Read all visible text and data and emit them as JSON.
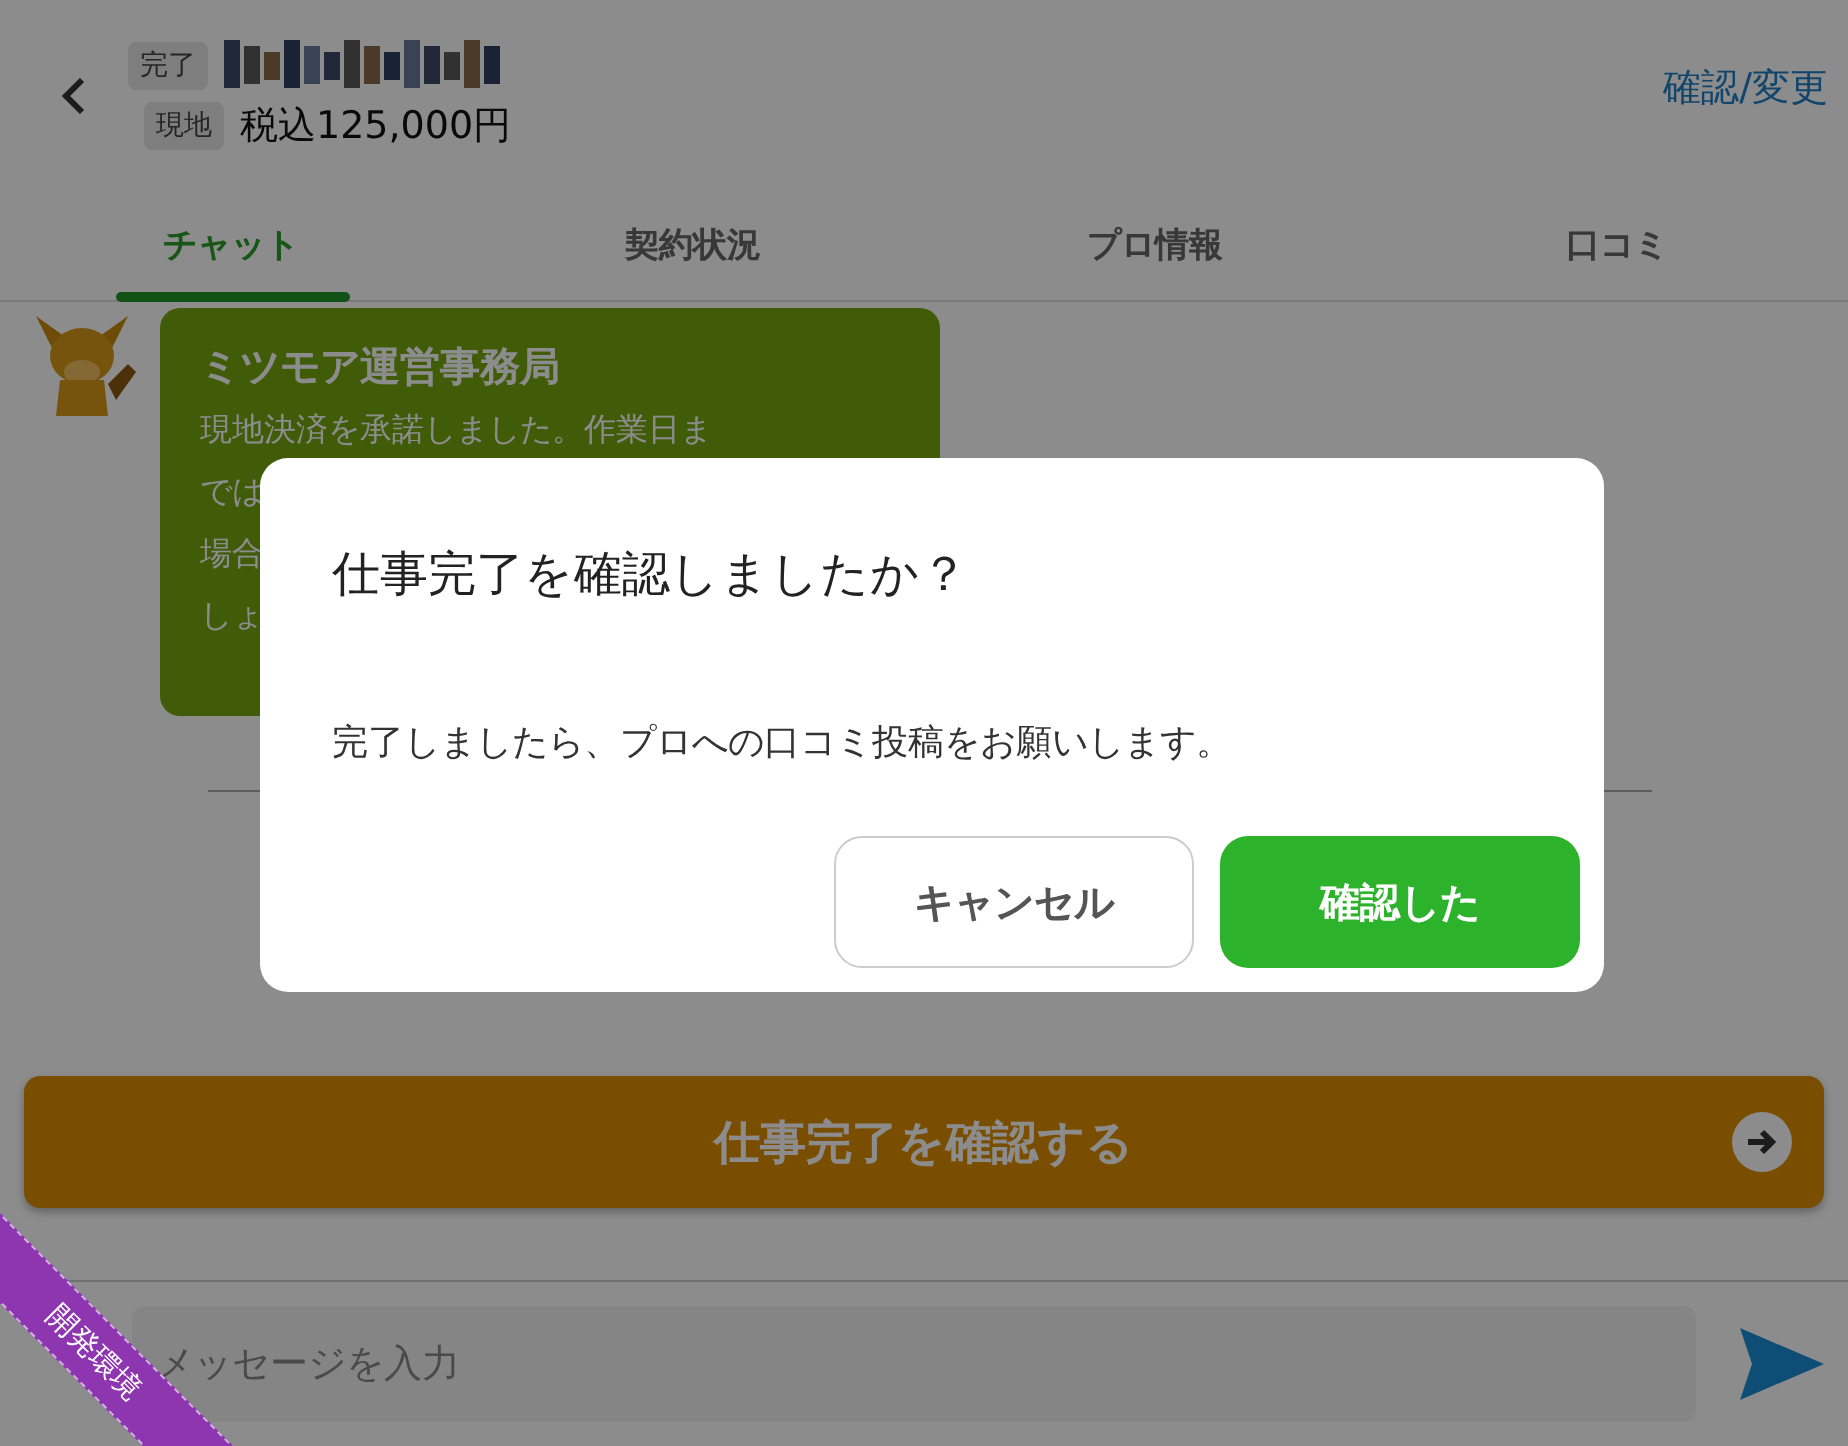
{
  "header": {
    "status_badge": "完了",
    "payment_badge": "現地",
    "price": "税込125,000円",
    "action_link": "確認/変更"
  },
  "tabs": [
    {
      "label": "チャット",
      "selected": true
    },
    {
      "label": "契約状況",
      "selected": false
    },
    {
      "label": "プロ情報",
      "selected": false
    },
    {
      "label": "口コミ",
      "selected": false
    }
  ],
  "messages": [
    {
      "sender": "ミツモア運営事務局",
      "lines": [
        "現地決済を承諾しました。作業日ま",
        "では",
        "場合",
        "しょ"
      ]
    }
  ],
  "complete_button": "仕事完了を確認する",
  "composer": {
    "placeholder": "メッセージを入力"
  },
  "env_ribbon": "開発環境",
  "dialog": {
    "title": "仕事完了を確認しましたか？",
    "message": "完了しましたら、プロへの口コミ投稿をお願いします。",
    "buttons": [
      {
        "label": "キャンセル",
        "kind": "secondary"
      },
      {
        "label": "確認した",
        "kind": "primary"
      }
    ]
  }
}
